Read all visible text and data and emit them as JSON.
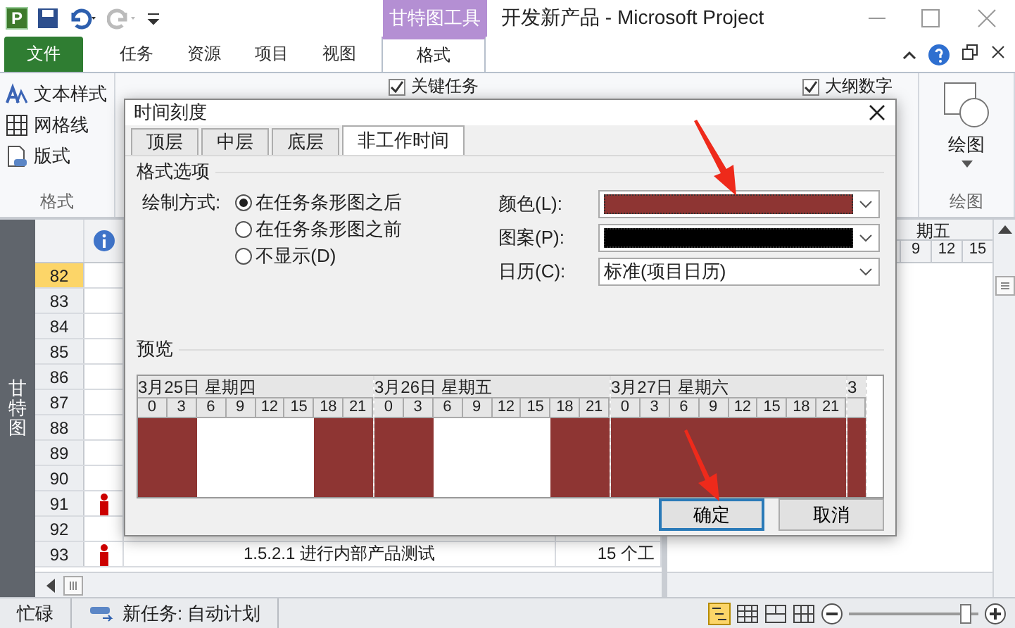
{
  "app_badge": "P",
  "contextual_group": "甘特图工具",
  "window_title": "开发新产品  -  Microsoft Project",
  "ribbon_tabs": [
    {
      "label": "文件",
      "kind": "file",
      "selected": false
    },
    {
      "label": "任务",
      "kind": "tab",
      "selected": false
    },
    {
      "label": "资源",
      "kind": "tab",
      "selected": false
    },
    {
      "label": "项目",
      "kind": "tab",
      "selected": false
    },
    {
      "label": "视图",
      "kind": "tab",
      "selected": false
    },
    {
      "label": "格式",
      "kind": "tab",
      "selected": true
    }
  ],
  "ribbon": {
    "format_items": [
      {
        "label": "文本样式",
        "kind": "text-style"
      },
      {
        "label": "网格线",
        "kind": "gridlines"
      },
      {
        "label": "版式",
        "kind": "layout"
      }
    ],
    "format_group_label": "格式",
    "checkboxes": [
      {
        "label": "关键任务",
        "checked": true
      },
      {
        "label": "大纲数字",
        "checked": true
      }
    ],
    "drawing_button": "绘图",
    "drawing_group_label": "绘图"
  },
  "view_bar": "甘特图",
  "table": {
    "rows": [
      {
        "id": "82",
        "selected": true,
        "person": false
      },
      {
        "id": "83",
        "selected": false,
        "person": false
      },
      {
        "id": "84",
        "selected": false,
        "person": false
      },
      {
        "id": "85",
        "selected": false,
        "person": false
      },
      {
        "id": "86",
        "selected": false,
        "person": false
      },
      {
        "id": "87",
        "selected": false,
        "person": false
      },
      {
        "id": "88",
        "selected": false,
        "person": false
      },
      {
        "id": "89",
        "selected": false,
        "person": false
      },
      {
        "id": "90",
        "selected": false,
        "person": false
      },
      {
        "id": "91",
        "selected": false,
        "person": true
      },
      {
        "id": "92",
        "selected": false,
        "person": false
      },
      {
        "id": "93",
        "selected": false,
        "person": true,
        "name": "1.5.2.1 进行内部产品测试",
        "duration": "15 个工"
      }
    ]
  },
  "timeline": {
    "day": "期五",
    "ticks": [
      "9",
      "12",
      "15"
    ]
  },
  "status_bar": {
    "mode": "忙碌",
    "new_tasks": "新任务: 自动计划",
    "zoom": {
      "level": 0.9
    }
  },
  "dialog": {
    "title": "时间刻度",
    "tabs": [
      {
        "label": "顶层",
        "selected": false
      },
      {
        "label": "中层",
        "selected": false
      },
      {
        "label": "底层",
        "selected": false
      },
      {
        "label": "非工作时间",
        "selected": true
      }
    ],
    "group_label": "格式选项",
    "draw_label": "绘制方式:",
    "draw_options": [
      {
        "label": "在任务条形图之后",
        "selected": true
      },
      {
        "label": "在任务条形图之前",
        "selected": false
      },
      {
        "label": "不显示(D)",
        "selected": false
      }
    ],
    "fields": [
      {
        "label": "颜色(L):",
        "kind": "swatch",
        "color": "#8e3533"
      },
      {
        "label": "图案(P):",
        "kind": "swatch",
        "color": "#000000"
      },
      {
        "label": "日历(C):",
        "kind": "text",
        "value": "标准(项目日历)"
      }
    ],
    "preview_label": "预览",
    "preview": {
      "days": [
        {
          "label": "3月25日  星期四",
          "hours": [
            {
              "label": "0",
              "nonworking": true
            },
            {
              "label": "3",
              "nonworking": true
            },
            {
              "label": "6",
              "nonworking": false
            },
            {
              "label": "9",
              "nonworking": false
            },
            {
              "label": "12",
              "nonworking": false
            },
            {
              "label": "15",
              "nonworking": false
            },
            {
              "label": "18",
              "nonworking": true
            },
            {
              "label": "21",
              "nonworking": true
            }
          ]
        },
        {
          "label": "3月26日  星期五",
          "hours": [
            {
              "label": "0",
              "nonworking": true
            },
            {
              "label": "3",
              "nonworking": true
            },
            {
              "label": "6",
              "nonworking": false
            },
            {
              "label": "9",
              "nonworking": false
            },
            {
              "label": "12",
              "nonworking": false
            },
            {
              "label": "15",
              "nonworking": false
            },
            {
              "label": "18",
              "nonworking": true
            },
            {
              "label": "21",
              "nonworking": true
            }
          ]
        },
        {
          "label": "3月27日  星期六",
          "hours": [
            {
              "label": "0",
              "nonworking": true
            },
            {
              "label": "3",
              "nonworking": true
            },
            {
              "label": "6",
              "nonworking": true
            },
            {
              "label": "9",
              "nonworking": true
            },
            {
              "label": "12",
              "nonworking": true
            },
            {
              "label": "15",
              "nonworking": true
            },
            {
              "label": "18",
              "nonworking": true
            },
            {
              "label": "21",
              "nonworking": true
            }
          ]
        },
        {
          "label": "3",
          "hours": [
            {
              "nonworking": true
            }
          ]
        }
      ]
    },
    "buttons": [
      {
        "label": "确定",
        "default": true
      },
      {
        "label": "取消",
        "default": false
      }
    ]
  }
}
